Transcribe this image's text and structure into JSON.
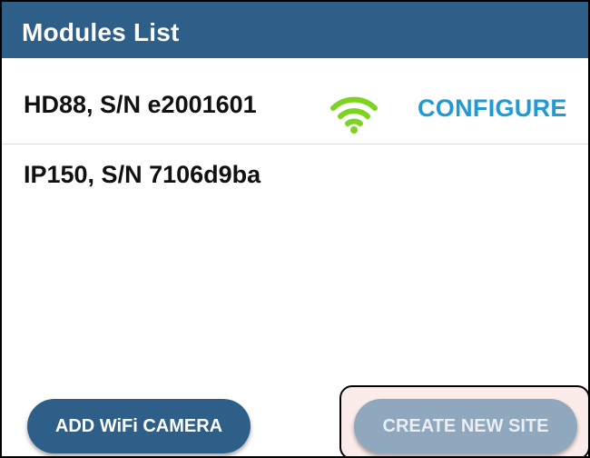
{
  "header": {
    "title": "Modules List"
  },
  "modules": [
    {
      "name": "HD88, S/N e2001601",
      "status_icon": "wifi-icon",
      "status_color": "#7ed321",
      "action_label": "CONFIGURE"
    },
    {
      "name": "IP150, S/N 7106d9ba"
    }
  ],
  "buttons": {
    "add_wifi_camera": "ADD WiFi CAMERA",
    "create_new_site": "CREATE NEW SITE"
  },
  "colors": {
    "header_bg": "#2e5f88",
    "accent": "#1f9ad4",
    "disabled_button": "#8fa8be"
  }
}
